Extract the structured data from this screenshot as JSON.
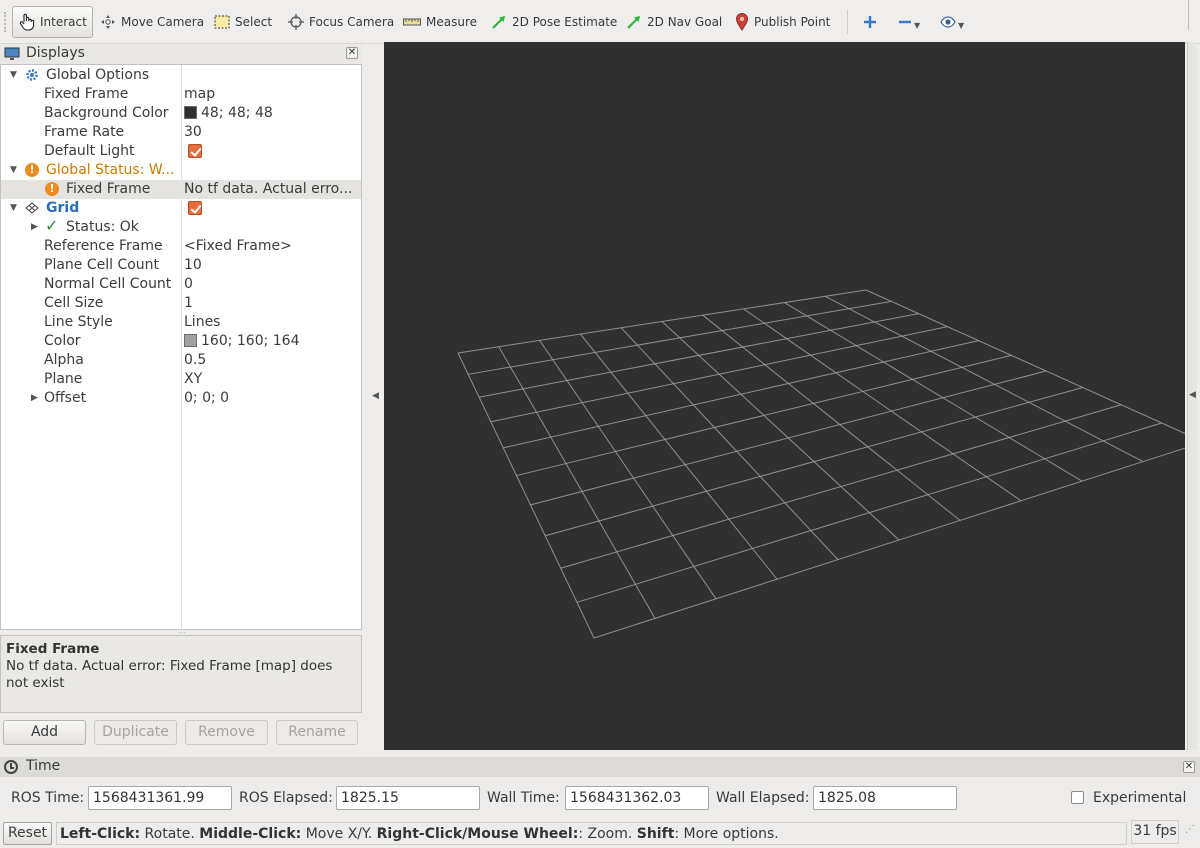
{
  "toolbar": {
    "interact": "Interact",
    "move_camera": "Move Camera",
    "select": "Select",
    "focus_camera": "Focus Camera",
    "measure": "Measure",
    "pose_estimate": "2D Pose Estimate",
    "nav_goal": "2D Nav Goal",
    "publish_point": "Publish Point"
  },
  "displays": {
    "title": "Displays",
    "global_options": {
      "label": "Global Options",
      "fixed_frame_label": "Fixed Frame",
      "fixed_frame_value": "map",
      "background_color_label": "Background Color",
      "background_color_value": "48; 48; 48",
      "background_color_hex": "#303030",
      "frame_rate_label": "Frame Rate",
      "frame_rate_value": "30",
      "default_light_label": "Default Light"
    },
    "global_status": {
      "label": "Global Status: W...",
      "fixed_frame_label": "Fixed Frame",
      "fixed_frame_value": "No tf data.  Actual erro..."
    },
    "grid": {
      "label": "Grid",
      "status_label": "Status: Ok",
      "reference_frame_label": "Reference Frame",
      "reference_frame_value": "<Fixed Frame>",
      "plane_cell_count_label": "Plane Cell Count",
      "plane_cell_count_value": "10",
      "normal_cell_count_label": "Normal Cell Count",
      "normal_cell_count_value": "0",
      "cell_size_label": "Cell Size",
      "cell_size_value": "1",
      "line_style_label": "Line Style",
      "line_style_value": "Lines",
      "color_label": "Color",
      "color_value": "160; 160; 164",
      "color_hex": "#a0a0a4",
      "alpha_label": "Alpha",
      "alpha_value": "0.5",
      "plane_label": "Plane",
      "plane_value": "XY",
      "offset_label": "Offset",
      "offset_value": "0; 0; 0"
    },
    "description": {
      "title": "Fixed Frame",
      "body": "No tf data. Actual error: Fixed Frame [map] does not exist"
    },
    "buttons": {
      "add": "Add",
      "duplicate": "Duplicate",
      "remove": "Remove",
      "rename": "Rename"
    }
  },
  "time": {
    "title": "Time",
    "ros_time_label": "ROS Time:",
    "ros_time_value": "1568431361.99",
    "ros_elapsed_label": "ROS Elapsed:",
    "ros_elapsed_value": "1825.15",
    "wall_time_label": "Wall Time:",
    "wall_time_value": "1568431362.03",
    "wall_elapsed_label": "Wall Elapsed:",
    "wall_elapsed_value": "1825.08",
    "experimental_label": "Experimental"
  },
  "statusbar": {
    "reset": "Reset",
    "hint_left_click": "Left-Click:",
    "hint_rotate": " Rotate. ",
    "hint_middle_click": "Middle-Click:",
    "hint_move": " Move X/Y. ",
    "hint_right_click": "Right-Click/Mouse Wheel:",
    "hint_zoom": ": Zoom. ",
    "hint_shift": "Shift",
    "hint_more": ": More options.",
    "fps": "31 fps"
  },
  "icons": [
    "hand-cursor-icon",
    "move-camera-icon",
    "select-box-icon",
    "focus-crosshair-icon",
    "ruler-icon",
    "green-arrow-icon",
    "map-pin-icon",
    "plus-icon",
    "minus-icon",
    "eye-icon",
    "monitor-icon",
    "gear-icon",
    "warning-icon",
    "grid-icon",
    "check-icon",
    "clock-icon"
  ]
}
